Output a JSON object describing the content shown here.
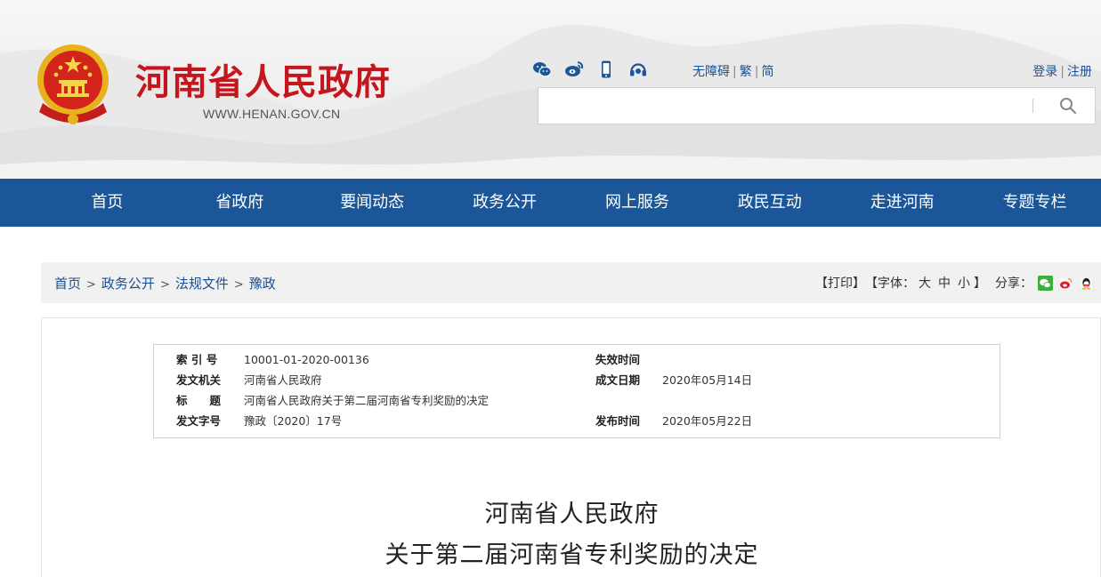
{
  "site": {
    "title": "河南省人民政府",
    "url": "WWW.HENAN.GOV.CN",
    "emblem_icon": "national-emblem-icon"
  },
  "top_links": {
    "accessibility": "无障碍",
    "traditional": "繁",
    "simplified": "简",
    "login": "登录",
    "register": "注册"
  },
  "social_icons": [
    "wechat-icon",
    "weibo-icon",
    "mobile-icon",
    "headset-icon"
  ],
  "search": {
    "placeholder": "",
    "button_icon": "search-icon"
  },
  "nav": {
    "items": [
      "首页",
      "省政府",
      "要闻动态",
      "政务公开",
      "网上服务",
      "政民互动",
      "走进河南",
      "专题专栏"
    ]
  },
  "breadcrumb": [
    "首页",
    "政务公开",
    "法规文件",
    "豫政"
  ],
  "tools": {
    "print": "【打印】",
    "font_label": "【字体：",
    "size_large": "大",
    "size_medium": "中",
    "size_small": "小",
    "font_close": "】",
    "share_label": "分享：",
    "share_icons": [
      "wechat-share-icon",
      "weibo-share-icon",
      "qq-share-icon"
    ]
  },
  "meta": {
    "index_label": "索 引 号",
    "index_value": "10001-01-2020-00136",
    "expire_label": "失效时间",
    "expire_value": "",
    "issuer_label": "发文机关",
    "issuer_value": "河南省人民政府",
    "created_label": "成文日期",
    "created_value": "2020年05月14日",
    "title_label": "标　　题",
    "title_value": "河南省人民政府关于第二届河南省专利奖励的决定",
    "docno_label": "发文字号",
    "docno_value": "豫政〔2020〕17号",
    "published_label": "发布时间",
    "published_value": "2020年05月22日"
  },
  "document": {
    "title_line1": "河南省人民政府",
    "title_line2": "关于第二届河南省专利奖励的决定"
  },
  "colors": {
    "brand_red": "#c6161d",
    "nav_blue": "#1b5699",
    "link_blue": "#1b4f93"
  }
}
